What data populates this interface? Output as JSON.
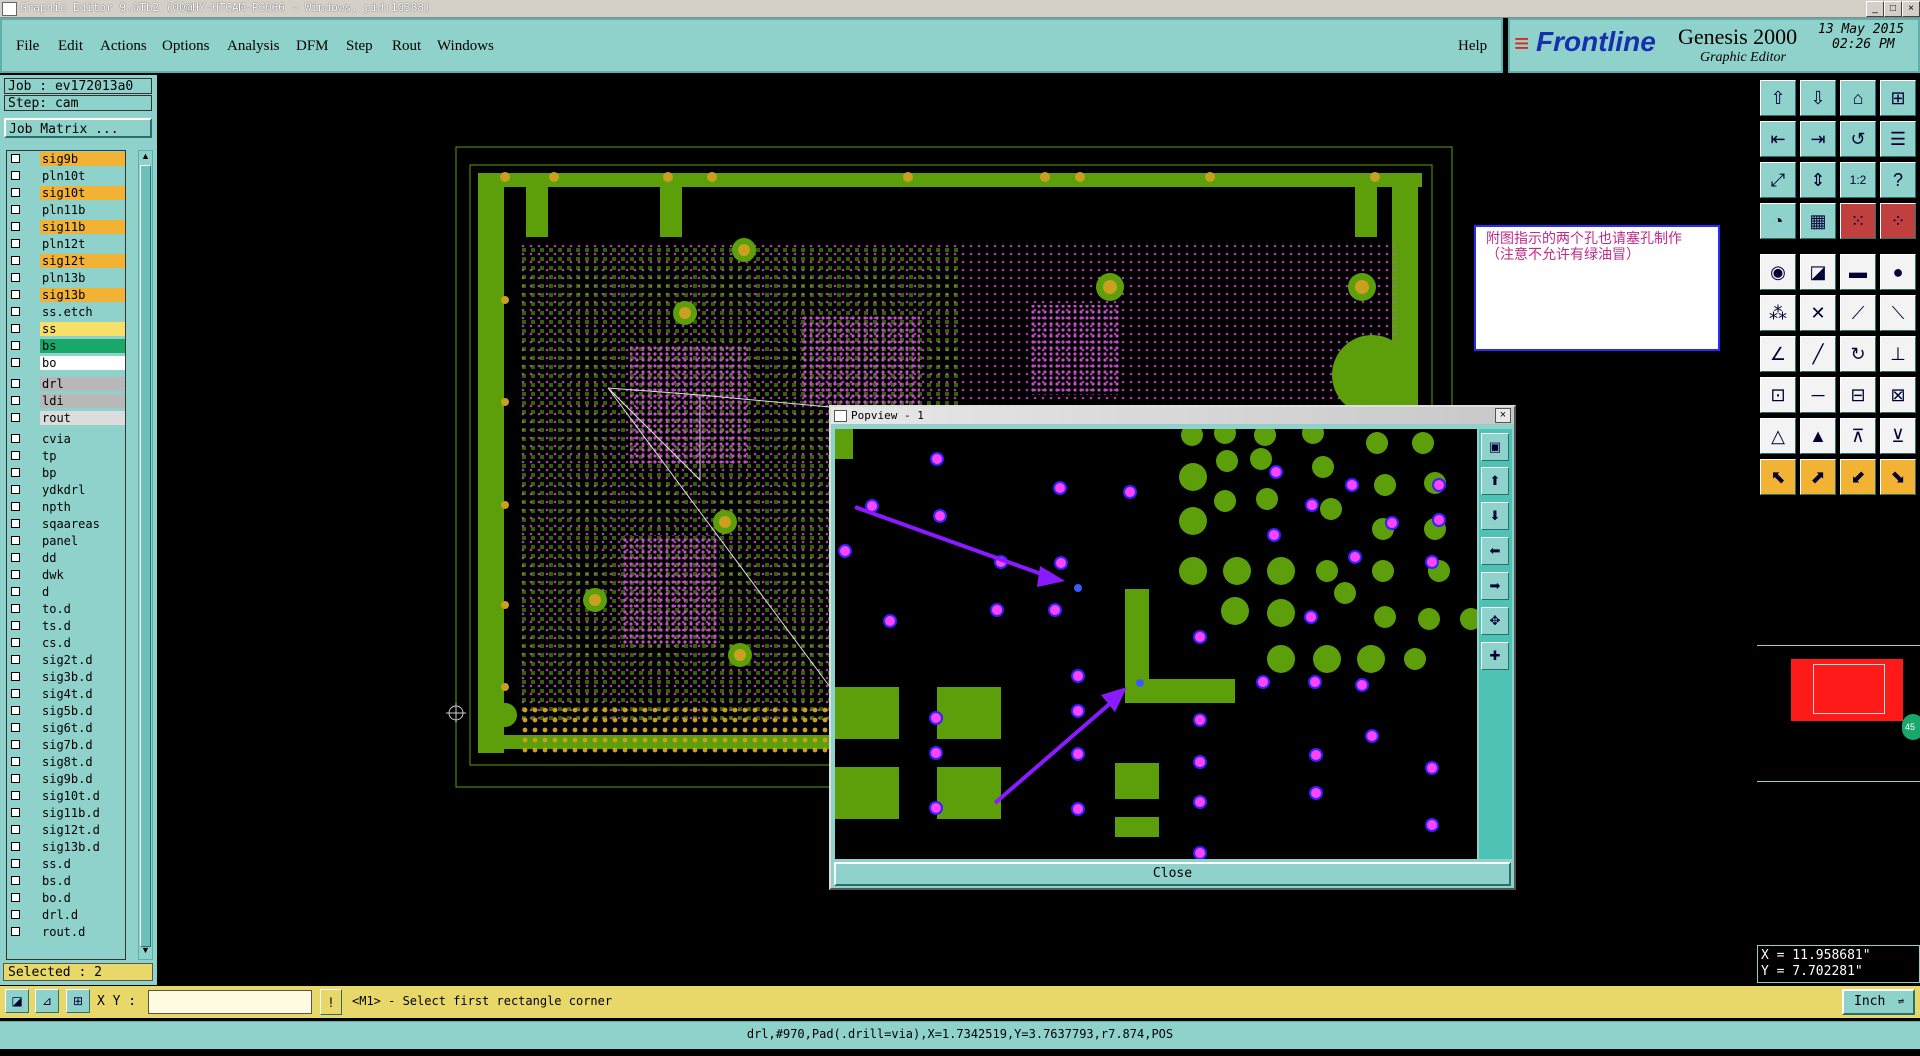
{
  "window": {
    "title": "Graphic Editor 9.0Tb2 (00@HY-HTCAM-PC066 - Windows, pid:10388)",
    "controls": [
      "_",
      "□",
      "×"
    ]
  },
  "menu": {
    "items": [
      "File",
      "Edit",
      "Actions",
      "Options",
      "Analysis",
      "DFM",
      "Step",
      "Rout",
      "Windows"
    ],
    "help": "Help"
  },
  "brand": {
    "logo": "Frontline",
    "product": "Genesis 2000",
    "subtitle": "Graphic Editor",
    "date": "13 May 2015",
    "time": "02:26 PM"
  },
  "job": {
    "job_label": "Job : ev172013a0",
    "step_label": "Step: cam",
    "matrix_button": "Job Matrix ..."
  },
  "layers": [
    {
      "name": "sig9b",
      "color": "#f2b233"
    },
    {
      "name": "pln10t",
      "color": "#8fd2cc"
    },
    {
      "name": "sig10t",
      "color": "#f2b233"
    },
    {
      "name": "pln11b",
      "color": "#8fd2cc"
    },
    {
      "name": "sig11b",
      "color": "#f2b233"
    },
    {
      "name": "pln12t",
      "color": "#8fd2cc"
    },
    {
      "name": "sig12t",
      "color": "#f2b233"
    },
    {
      "name": "pln13b",
      "color": "#8fd2cc"
    },
    {
      "name": "sig13b",
      "color": "#f2b233"
    },
    {
      "name": "ss.etch",
      "color": "#8fd2cc"
    },
    {
      "name": "ss",
      "color": "#f6e06a"
    },
    {
      "name": "bs",
      "color": "#1aa86a"
    },
    {
      "name": "bo",
      "color": "#ffffff"
    },
    {
      "name": "drl",
      "color": "#b8b8b8"
    },
    {
      "name": "ldi",
      "color": "#b8b8b8"
    },
    {
      "name": "rout",
      "color": "#dcdcdc"
    },
    {
      "name": "cvia",
      "color": "#8fd2cc"
    },
    {
      "name": "tp",
      "color": "#8fd2cc"
    },
    {
      "name": "bp",
      "color": "#8fd2cc"
    },
    {
      "name": "ydkdrl",
      "color": "#8fd2cc"
    },
    {
      "name": "npth",
      "color": "#8fd2cc"
    },
    {
      "name": "sqaareas",
      "color": "#8fd2cc"
    },
    {
      "name": "panel",
      "color": "#8fd2cc"
    },
    {
      "name": "dd",
      "color": "#8fd2cc"
    },
    {
      "name": "dwk",
      "color": "#8fd2cc"
    },
    {
      "name": "d",
      "color": "#8fd2cc"
    },
    {
      "name": "to.d",
      "color": "#8fd2cc"
    },
    {
      "name": "ts.d",
      "color": "#8fd2cc"
    },
    {
      "name": "cs.d",
      "color": "#8fd2cc"
    },
    {
      "name": "sig2t.d",
      "color": "#8fd2cc"
    },
    {
      "name": "sig3b.d",
      "color": "#8fd2cc"
    },
    {
      "name": "sig4t.d",
      "color": "#8fd2cc"
    },
    {
      "name": "sig5b.d",
      "color": "#8fd2cc"
    },
    {
      "name": "sig6t.d",
      "color": "#8fd2cc"
    },
    {
      "name": "sig7b.d",
      "color": "#8fd2cc"
    },
    {
      "name": "sig8t.d",
      "color": "#8fd2cc"
    },
    {
      "name": "sig9b.d",
      "color": "#8fd2cc"
    },
    {
      "name": "sig10t.d",
      "color": "#8fd2cc"
    },
    {
      "name": "sig11b.d",
      "color": "#8fd2cc"
    },
    {
      "name": "sig12t.d",
      "color": "#8fd2cc"
    },
    {
      "name": "sig13b.d",
      "color": "#8fd2cc"
    },
    {
      "name": "ss.d",
      "color": "#8fd2cc"
    },
    {
      "name": "bs.d",
      "color": "#8fd2cc"
    },
    {
      "name": "bo.d",
      "color": "#8fd2cc"
    },
    {
      "name": "drl.d",
      "color": "#8fd2cc"
    },
    {
      "name": "rout.d",
      "color": "#8fd2cc"
    }
  ],
  "selected": "Selected : 2",
  "note": "附图指示的两个孔也请塞孔制作（注意不允许有绿油冒）",
  "popview": {
    "title": "Popview - 1",
    "close": "Close"
  },
  "coords": {
    "x": "X = 11.958681\"",
    "y": "Y = 7.702281\""
  },
  "command": {
    "xy_label": "X Y :",
    "xy_value": "",
    "prompt": "<M1> - Select first rectangle corner",
    "units": "Inch"
  },
  "status": "drl,#970,Pad(.drill=via),X=1.7342519,Y=3.7637793,r7.874,POS",
  "colors": {
    "ui_teal": "#8fd2cc",
    "pcb_green": "#5c9f0a",
    "via_magenta": "#ff44ff",
    "drill_blue": "#2a2aff",
    "arrow_purple": "#8a1aff"
  }
}
